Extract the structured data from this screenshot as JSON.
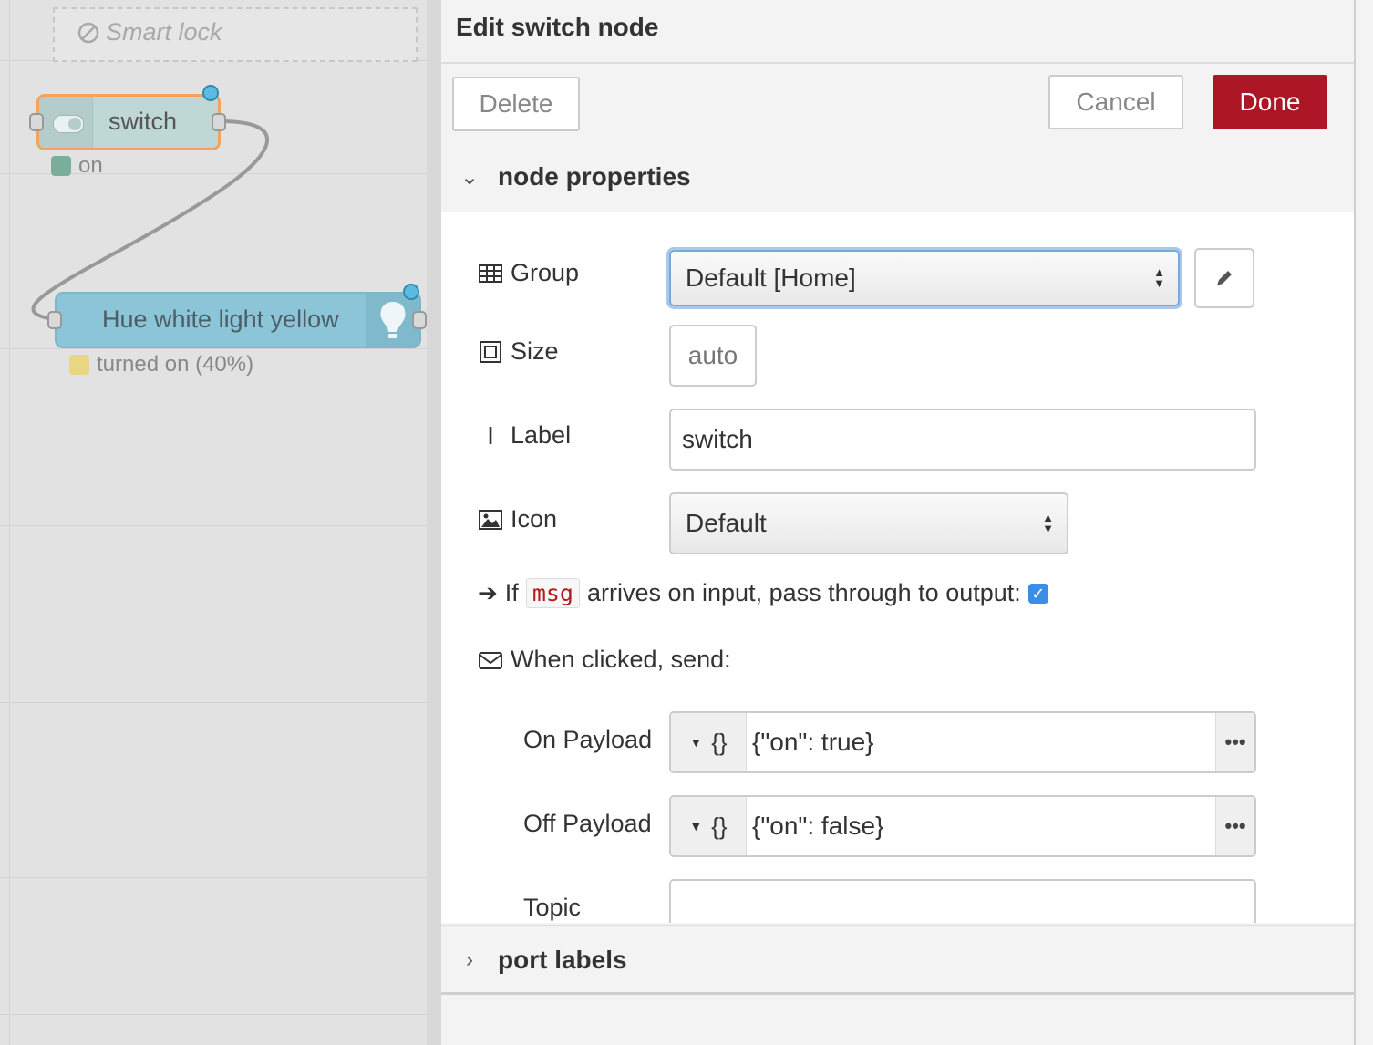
{
  "workspace": {
    "group_label": "Smart lock",
    "nodes": {
      "switch": {
        "label": "switch",
        "status": "on",
        "status_color": "#7aae9a"
      },
      "hue": {
        "label": "Hue white light yellow",
        "status": "turned on (40%)",
        "status_color": "#e8d683"
      }
    },
    "colors": {
      "switch_fill": "#bfd8d6",
      "switch_border": "#f3a35c",
      "hue_fill": "#8cc5d8",
      "wire": "#999999"
    }
  },
  "tray": {
    "title": "Edit switch node",
    "buttons": {
      "delete": "Delete",
      "cancel": "Cancel",
      "done": "Done"
    },
    "sections": {
      "node_properties": "node properties",
      "port_labels": "port labels"
    },
    "fields": {
      "group": {
        "label": "Group",
        "value": "Default [Home]"
      },
      "size": {
        "label": "Size",
        "value": "auto"
      },
      "label": {
        "label": "Label",
        "value": "switch"
      },
      "icon": {
        "label": "Icon",
        "value": "Default"
      },
      "passthrough": {
        "prefix": "If",
        "code": "msg",
        "suffix": "arrives on input, pass through to output:",
        "checked": true
      },
      "when_clicked": "When clicked, send:",
      "on_payload": {
        "label": "On Payload",
        "type": "{}",
        "value": "{\"on\": true}"
      },
      "off_payload": {
        "label": "Off Payload",
        "type": "{}",
        "value": "{\"on\": false}"
      },
      "topic": {
        "label": "Topic",
        "value": ""
      }
    },
    "colors": {
      "done_bg": "#ad1625",
      "accent": "#3a8ee6"
    }
  }
}
